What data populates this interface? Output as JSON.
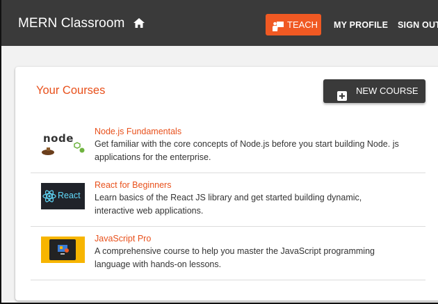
{
  "appbar": {
    "title": "MERN Classroom",
    "home_icon": "home-icon",
    "teach_label": "TEACH",
    "teach_icon": "teacher-icon",
    "my_profile_label": "MY PROFILE",
    "sign_out_label": "SIGN OUT"
  },
  "colors": {
    "appbar_bg": "#3a3a3a",
    "accent": "#f05923",
    "title_orange": "#e8501b",
    "button_dark": "#3a3a3a"
  },
  "courses_card": {
    "title": "Your Courses",
    "new_course_label": "NEW COURSE",
    "new_course_icon": "add-box-icon"
  },
  "courses": [
    {
      "title": "Node.js Fundamentals",
      "description": "Get familiar with the core concepts of Node.js before you start building Node. js applications for the enterprise.",
      "thumb_text": "node",
      "thumb_icon": "nodejs-logo-icon"
    },
    {
      "title": "React for Beginners",
      "description": "Learn basics of the React JS library and get started building dynamic, interactive web applications.",
      "thumb_text": "React",
      "thumb_icon": "react-logo-icon"
    },
    {
      "title": "JavaScript Pro",
      "description": "A comprehensive course to help you master the JavaScript programming language with hands-on lessons.",
      "thumb_icon": "javascript-course-icon"
    }
  ]
}
